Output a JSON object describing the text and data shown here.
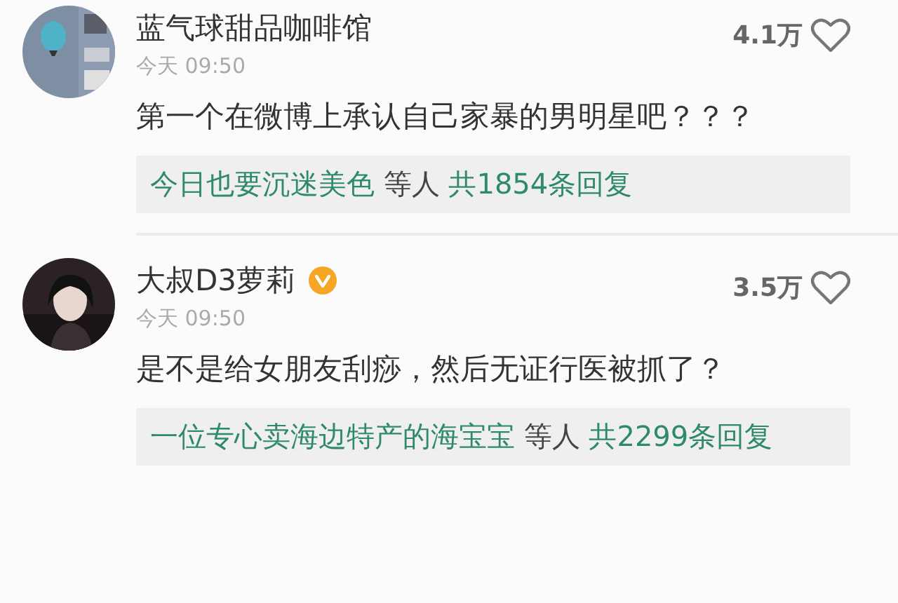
{
  "comments": [
    {
      "author": "蓝气球甜品咖啡馆",
      "verified": false,
      "time": "今天 09:50",
      "likes": "4.1万",
      "liked": false,
      "text": "第一个在微博上承认自己家暴的男明星吧？？？",
      "replies": {
        "users": "今日也要沉迷美色",
        "others": "等人",
        "count": "共1854条回复"
      }
    },
    {
      "author": "大叔D3萝莉",
      "verified": true,
      "time": "今天 09:50",
      "likes": "3.5万",
      "liked": false,
      "text": "是不是给女朋友刮痧，然后无证行医被抓了？",
      "replies": {
        "users": "一位专心卖海边特产的海宝宝",
        "others": "等人",
        "count": "共2299条回复"
      }
    }
  ]
}
